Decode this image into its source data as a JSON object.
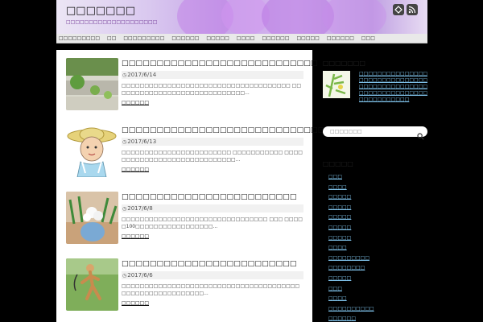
{
  "header": {
    "site_title": "□□□□□□□",
    "site_description": "□□□□□□□□□□□□□□□□□□□□",
    "icons": [
      "feedly-icon",
      "rss-icon"
    ]
  },
  "nav": {
    "items": [
      "□□□□□□□□□",
      "□□",
      "□□□□□□□□□",
      "□□□□□□",
      "□□□□□",
      "□□□□",
      "□□□□□□",
      "□□□□□",
      "□□□□□□",
      "□□□"
    ]
  },
  "posts": [
    {
      "title": "□□□□□□□□□□□□□□□□□□□□□□□□□□□□",
      "date": "2017/6/14",
      "excerpt": "□□□□□□□□□□□□□□□□□□□□□□□□□□□□□□□□□□□□□ □□□□□□□□□□□□□□□□□□□□□□□□□□□□□...",
      "readmore": "□□□□□□"
    },
    {
      "title": "□□□□□□□□□□□□□□□□□□□□□□□□□□□□□□□□□□",
      "date": "2017/6/13",
      "excerpt": "□□□□□□□□□□□□□□□□□□□□□□□□ □□□□□□□□□□□ □□□□□□□□□□□□□□□□□□□□□□□□□□□□□...",
      "readmore": "□□□□□□"
    },
    {
      "title": "□□□□□□□□□□□□□□□□□□□□□□□□□",
      "date": "2017/6/8",
      "excerpt": "□□□□□□□□□□□□□□□□□□□□□□□□□□□□□□□□ □□□ □□□□□100□□□□□□□□□□□□□□□□□...",
      "readmore": "□□□□□□"
    },
    {
      "title": "□□□□□□□□□□□□□□□□□□□□□□□□□",
      "date": "2017/6/6",
      "excerpt": "□□□□□□□□□□□□□□□□□□□□□□□□□□□□□□□□□□□□□□□□□□□□□□□□□□□□□□□□□...",
      "readmore": "□□□□□□"
    }
  ],
  "sidebar": {
    "popular_title": "□□□□□□□",
    "popular_text": "□□□□□□□□□□□□□□□ □□□□□□□□□□□□□□□□□□□□□□□□□□□□□□□□□□□□□□□□□□□□□□□□□□□□□□□□",
    "search_placeholder": "□□□□□□□",
    "category_title": "□□□□□",
    "categories": [
      "□□□",
      "□□□□",
      "□□□□□",
      "□□□□□",
      "□□□□□",
      "□□□□□",
      "□□□□□",
      "□□□□",
      "□□□□□□□□□",
      "□□□□□□□□",
      "□□□□□",
      "□□□",
      "□□□□",
      "□□□□□□□□□□",
      "□□□□□□"
    ]
  }
}
